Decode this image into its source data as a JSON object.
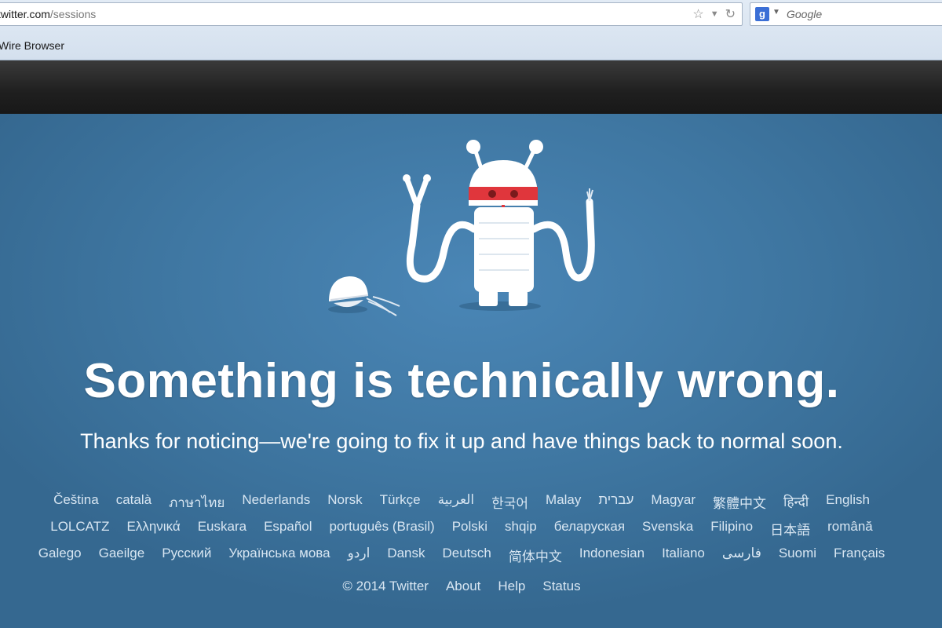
{
  "browser": {
    "url_host": "twitter.com",
    "url_path": "/sessions",
    "search_placeholder": "Google",
    "search_engine_icon": "google-g-icon",
    "bookmark": "Wire Browser"
  },
  "error": {
    "headline": "Something is technically wrong.",
    "message": "Thanks for noticing—we're going to fix it up and have things back to normal soon."
  },
  "languages": {
    "row1": [
      "Čeština",
      "català",
      "ภาษาไทย",
      "Nederlands",
      "Norsk",
      "Türkçe",
      "العربية",
      "한국어",
      "Malay",
      "עברית",
      "Magyar",
      "繁體中文",
      "हिन्दी",
      "English"
    ],
    "row2": [
      "LOLCATZ",
      "Ελληνικά",
      "Euskara",
      "Español",
      "português (Brasil)",
      "Polski",
      "shqip",
      "беларуская",
      "Svenska",
      "Filipino",
      "日本語",
      "română"
    ],
    "row3": [
      "Galego",
      "Gaeilge",
      "Русский",
      "Українська мова",
      "اردو",
      "Dansk",
      "Deutsch",
      "简体中文",
      "Indonesian",
      "Italiano",
      "فارسی",
      "Suomi",
      "Français"
    ]
  },
  "footer": {
    "copyright": "© 2014 Twitter",
    "links": [
      "About",
      "Help",
      "Status"
    ]
  },
  "colors": {
    "page_bg": "#3f77a2",
    "robot_band": "#e0363c",
    "text": "#ffffff"
  }
}
